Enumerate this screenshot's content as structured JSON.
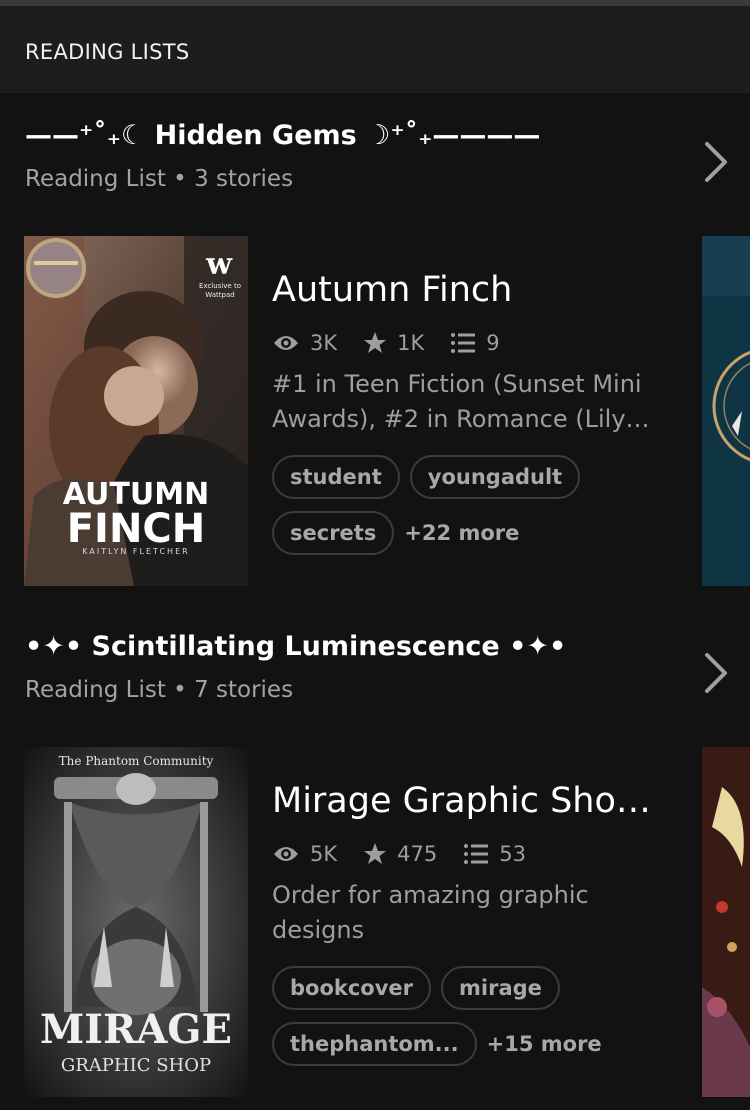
{
  "header": {
    "title": "READING LISTS"
  },
  "lists": [
    {
      "title": "——⁺˚₊☾ Hidden Gems ☽⁺˚₊————",
      "meta": "Reading List • 3 stories",
      "story": {
        "title": "Autumn Finch",
        "views": "3K",
        "votes": "1K",
        "parts": "9",
        "description": "#1 in Teen Fiction (Sunset Mini Awards), #2 in Romance (Lily A…",
        "tags": [
          "student",
          "youngadult",
          "secrets"
        ],
        "more": "+22 more",
        "cover_title_line1": "AUTUMN",
        "cover_title_line2": "FINCH",
        "cover_author": "KAITLYN FLETCHER",
        "cover_badge": "Exclusive to Wattpad"
      }
    },
    {
      "title": "•✦• Scintillating Luminescence •✦•",
      "meta": "Reading List • 7 stories",
      "story": {
        "title": "Mirage Graphic Sho…",
        "views": "5K",
        "votes": "475",
        "parts": "53",
        "description": "Order for amazing graphic designs",
        "tags": [
          "bookcover",
          "mirage",
          "thephantom..."
        ],
        "more": "+15 more",
        "cover_top": "The Phantom Community",
        "cover_title": "MIRAGE",
        "cover_sub": "GRAPHIC SHOP"
      }
    }
  ],
  "icons": {
    "views": "eye-icon",
    "votes": "star-icon",
    "parts": "list-icon",
    "next": "chevron-right-icon"
  },
  "colors": {
    "background": "#121212",
    "header": "#1d1d1e",
    "muted_text": "#9e9e9e",
    "tag_border": "#3c3c3c"
  }
}
